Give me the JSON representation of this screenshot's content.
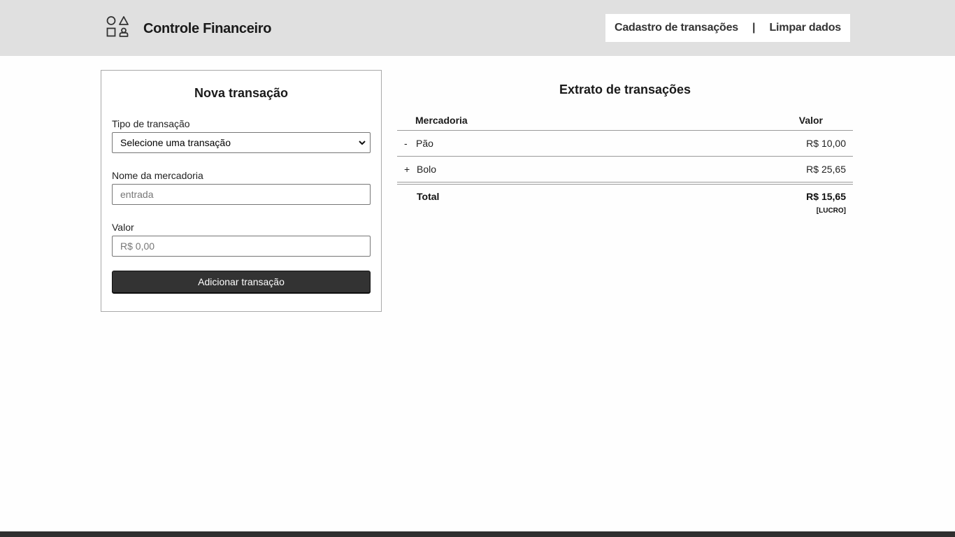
{
  "header": {
    "brand": "Controle Financeiro",
    "logo_icon": "shapes-icon",
    "nav": {
      "register_label": "Cadastro de transações",
      "separator": "|",
      "clear_label": "Limpar dados"
    }
  },
  "form": {
    "title": "Nova transação",
    "type_label": "Tipo de transação",
    "type_selected": "Selecione uma transação",
    "name_label": "Nome da mercadoria",
    "name_placeholder": "entrada",
    "value_label": "Valor",
    "value_placeholder": "R$ 0,00",
    "submit_label": "Adicionar transação"
  },
  "extract": {
    "title": "Extrato de transações",
    "columns": {
      "item": "Mercadoria",
      "value": "Valor"
    },
    "rows": [
      {
        "sign": "-",
        "name": "Pão",
        "value": "R$ 10,00"
      },
      {
        "sign": "+",
        "name": "Bolo",
        "value": "R$ 25,65"
      }
    ],
    "total": {
      "label": "Total",
      "value": "R$ 15,65",
      "status": "[LUCRO]"
    }
  },
  "colors": {
    "header_bg": "#e0e0e0",
    "button_bg": "#333333",
    "footer_bg": "#2f2f2f"
  }
}
